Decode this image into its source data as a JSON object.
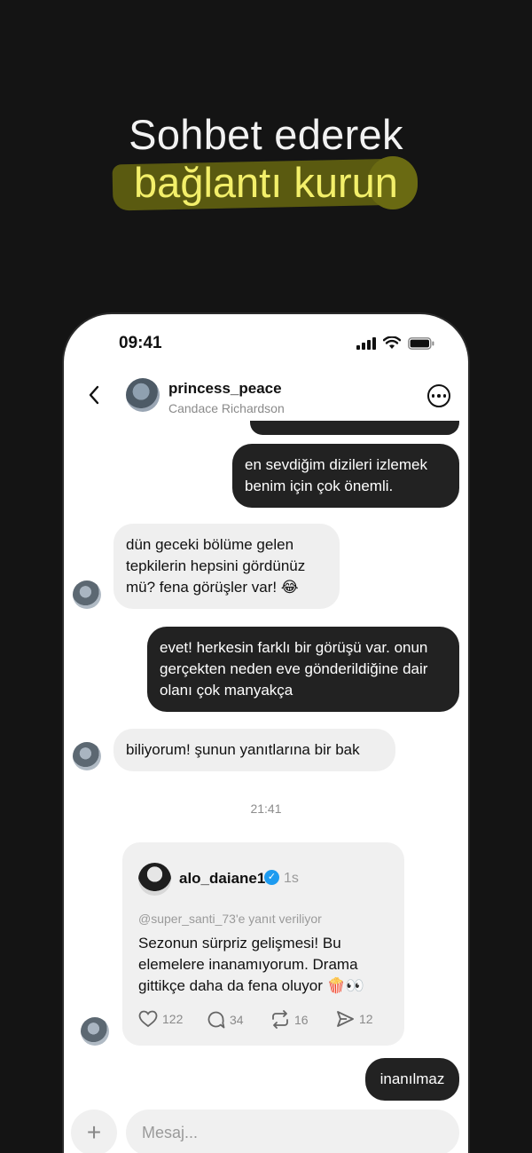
{
  "headline": {
    "line1": "Sohbet ederek",
    "line2": "bağlantı kurun",
    "highlight_color": "#f3ef6a"
  },
  "status_bar": {
    "time": "09:41",
    "icons": [
      "signal-icon",
      "wifi-icon",
      "battery-icon"
    ]
  },
  "chat_header": {
    "username": "princess_peace",
    "real_name": "Candace Richardson",
    "back_icon": "chevron-left-icon",
    "more_icon": "more-options-icon"
  },
  "messages": [
    {
      "from": "me",
      "text": ""
    },
    {
      "from": "me",
      "text": "en sevdiğim dizileri izlemek benim için çok önemli."
    },
    {
      "from": "them",
      "text": "dün geceki bölüme gelen tepkilerin hepsini gördünüz mü? fena görüşler var! 😂"
    },
    {
      "from": "me",
      "text": "evet! herkesin farklı bir görüşü var. onun gerçekten neden eve gönderildiğine dair olanı çok manyakça"
    },
    {
      "from": "them",
      "text": "biliyorum! şunun yanıtlarına bir bak"
    }
  ],
  "timestamp": "21:41",
  "shared_post": {
    "username": "alo_daiane1",
    "verified": true,
    "time": "1s",
    "reply_to": "@super_santi_73'e yanıt veriliyor",
    "text": "Sezonun sürpriz gelişmesi! Bu elemelere inanamıyorum. Drama gittikçe daha da fena oluyor 🍿👀",
    "likes": "122",
    "replies": "34",
    "reposts": "16",
    "shares": "12"
  },
  "last_message": {
    "from": "me",
    "text": "inanılmaz"
  },
  "composer": {
    "placeholder": "Mesaj...",
    "plus_icon": "plus-icon"
  },
  "colors": {
    "background": "#141414",
    "outgoing_bubble": "#222222",
    "incoming_bubble": "#efefef",
    "verified_badge": "#1d9bf0"
  }
}
